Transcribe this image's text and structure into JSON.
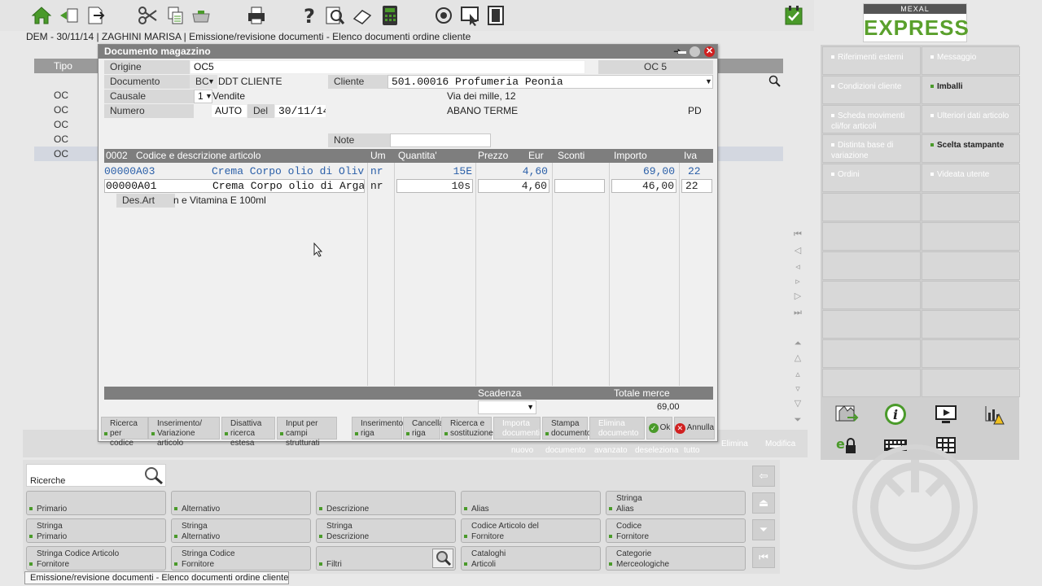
{
  "header": {
    "status_line": "DEM - 30/11/14 | ZAGHINI MARISA | Emissione/revisione documenti - Elenco documenti ordine cliente",
    "logo_top": "MEXAL",
    "logo_main": "EXPRESS"
  },
  "background_list": {
    "column_tipo": "Tipo",
    "rows": [
      "OC",
      "OC",
      "OC",
      "OC",
      "OC"
    ]
  },
  "dialog": {
    "title": "Documento magazzino",
    "origine_label": "Origine",
    "origine_value": "OC5",
    "origine_right": "OC 5",
    "documento_label": "Documento",
    "documento_code": "BC",
    "documento_desc": "DDT CLIENTE",
    "cliente_label": "Cliente",
    "cliente_value": "501.00016 Profumeria Peonia",
    "causale_label": "Causale",
    "causale_value": "1",
    "causale_desc": "Vendite",
    "address": "Via dei mille, 12",
    "city": "ABANO TERME",
    "province": "PD",
    "numero_label": "Numero",
    "numero_value": "AUTO",
    "del_label": "Del",
    "del_value": "30/11/14",
    "note_label": "Note",
    "note_value": "",
    "grid": {
      "count": "0002",
      "col_codice": "Codice e descrizione articolo",
      "col_um": "Um",
      "col_qta": "Quantita'",
      "col_prezzo": "Prezzo",
      "col_eur": "Eur",
      "col_sconti": "Sconti",
      "col_importo": "Importo",
      "col_iva": "Iva",
      "rows": [
        {
          "code": "00000A03",
          "desc": "Crema Corpo olio di Oliv",
          "um": "nr",
          "qty": "15E",
          "prezzo": "4,60",
          "sconti": "",
          "importo": "69,00",
          "iva": "22"
        },
        {
          "code": "00000A01",
          "desc": "Crema Corpo olio di Arga",
          "um": "nr",
          "qty": "10s",
          "prezzo": "4,60",
          "sconti": "",
          "importo": "46,00",
          "iva": "22"
        }
      ],
      "des_art_label": "Des.Art",
      "des_art_value": "n e Vitamina E 100ml"
    },
    "scadenza_label": "Scadenza",
    "totale_label": "Totale merce",
    "totale_value": "69,00",
    "buttons": {
      "ricerca_codice": [
        "Ricerca",
        "per codice"
      ],
      "inserimento_var": [
        "Inserimento/",
        "Variazione articolo"
      ],
      "disattiva": [
        "Disattiva",
        "ricerca estesa"
      ],
      "input_campi": [
        "Input per campi",
        "strutturati"
      ],
      "inserimento_riga": [
        "Inserimento",
        "riga"
      ],
      "cancella_riga": [
        "Cancella",
        "riga"
      ],
      "ricerca_sost": [
        "Ricerca e",
        "sostituzione"
      ],
      "importa_doc": [
        "Importa",
        "documenti"
      ],
      "stampa_doc": [
        "Stampa",
        "documento"
      ],
      "elimina_doc": [
        "Elimina",
        "documento"
      ],
      "ok": "Ok",
      "annulla": "Annulla"
    }
  },
  "strip": {
    "labels": [
      "nuovo",
      "documento",
      "avanzato",
      "deseleziona",
      "tutto"
    ],
    "elimina": "Elimina",
    "modifica": "Modifica"
  },
  "right_panel": {
    "buttons": [
      {
        "label": "Riferimenti esterni",
        "dark": false
      },
      {
        "label": "Messaggio",
        "dark": false
      },
      {
        "label": "Condizioni cliente",
        "dark": false
      },
      {
        "label": "Imballi",
        "dark": true
      },
      {
        "label": "Scheda movimenti cli/for articoli",
        "dark": false
      },
      {
        "label": "Ulteriori dati articolo",
        "dark": false
      },
      {
        "label": "Distinta base di variazione",
        "dark": false
      },
      {
        "label": "Scelta stampante",
        "dark": true
      },
      {
        "label": "Ordini",
        "dark": false
      },
      {
        "label": "Videata utente",
        "dark": false
      }
    ]
  },
  "search": {
    "ricerche_label": "Ricerche",
    "buttons": [
      [
        "",
        "Primario"
      ],
      [
        "",
        "Alternativo"
      ],
      [
        "",
        "Descrizione"
      ],
      [
        "",
        "Alias"
      ],
      [
        "Stringa",
        "Alias"
      ],
      [
        "Stringa",
        "Primario"
      ],
      [
        "Stringa",
        "Alternativo"
      ],
      [
        "Stringa",
        "Descrizione"
      ],
      [
        "Codice Articolo del",
        "Fornitore"
      ],
      [
        "Codice",
        "Fornitore"
      ],
      [
        "Stringa Codice Articolo",
        "Fornitore"
      ],
      [
        "Stringa Codice",
        "Fornitore"
      ],
      [
        "",
        "Filtri"
      ],
      [
        "Cataloghi",
        "Articoli"
      ],
      [
        "Categorie",
        "Merceologiche"
      ]
    ]
  },
  "footer": "Emissione/revisione documenti - Elenco documenti ordine cliente",
  "colors": {
    "accent_green": "#4a9a2a",
    "header_gray": "#7e7e7e",
    "blue_text": "#2a5fa8",
    "close_red": "#d02020"
  }
}
